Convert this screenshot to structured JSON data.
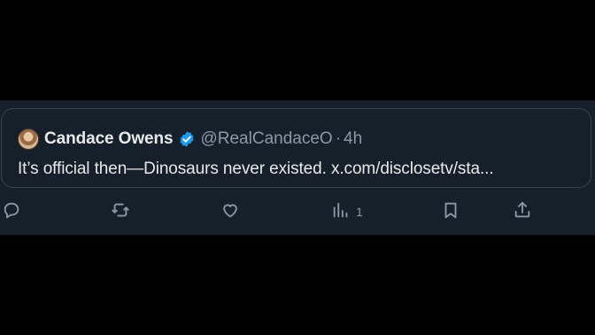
{
  "quote": {
    "display_name": "Candace Owens",
    "handle": "@RealCandaceO",
    "separator": "·",
    "time": "4h",
    "text": "It’s official then—Dinosaurs never existed. x.com/disclosetv/sta..."
  },
  "actions": {
    "views_count": "1"
  },
  "colors": {
    "background": "#000000",
    "panel": "#15202b",
    "border": "#38444d",
    "primary_text": "#e7e9ea",
    "secondary_text": "#8b98a5",
    "verified": "#1d9bf0"
  },
  "icons": [
    "reply-icon",
    "retweet-icon",
    "like-icon",
    "views-icon",
    "bookmark-icon",
    "share-icon",
    "verified-badge-icon"
  ]
}
